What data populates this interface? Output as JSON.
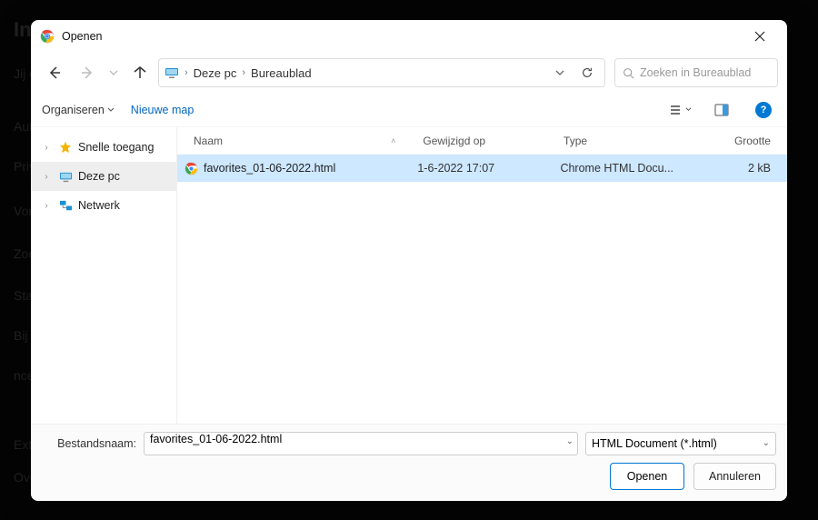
{
  "background_lines": [
    "Jij e",
    "Auto",
    "Priv",
    "Vorn",
    "Zoek",
    "Stan",
    "Bij o",
    "ncee",
    "Exte",
    "Over"
  ],
  "background_title": "Inst",
  "dialog": {
    "title": "Openen",
    "nav": {
      "search_placeholder": "Zoeken in Bureaublad"
    },
    "breadcrumb": [
      "Deze pc",
      "Bureaublad"
    ],
    "commands": {
      "organize": "Organiseren",
      "new_folder": "Nieuwe map"
    },
    "sidebar": {
      "items": [
        {
          "label": "Snelle toegang"
        },
        {
          "label": "Deze pc"
        },
        {
          "label": "Netwerk"
        }
      ]
    },
    "columns": {
      "name": "Naam",
      "modified": "Gewijzigd op",
      "type": "Type",
      "size": "Grootte"
    },
    "rows": [
      {
        "name": "favorites_01-06-2022.html",
        "modified": "1-6-2022 17:07",
        "type": "Chrome HTML Docu...",
        "size": "2 kB"
      }
    ],
    "filename_label": "Bestandsnaam:",
    "filename_value": "favorites_01-06-2022.html",
    "filter_value": "HTML Document (*.html)",
    "open_btn": "Openen",
    "cancel_btn": "Annuleren",
    "help_glyph": "?"
  }
}
